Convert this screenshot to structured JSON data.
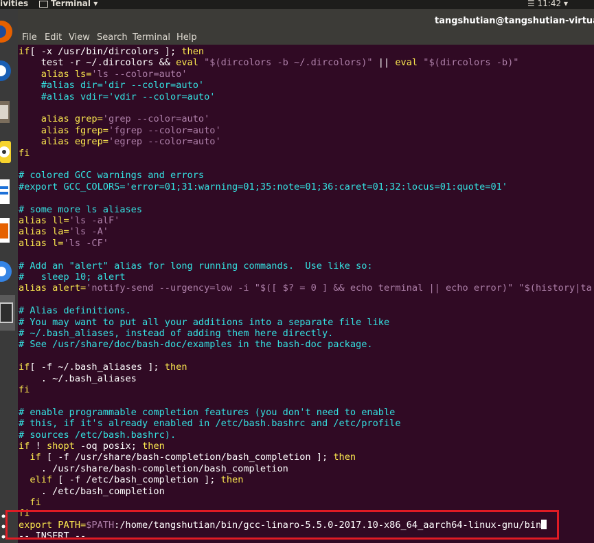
{
  "topbar": {
    "activities": "ivities",
    "app_menu": "Terminal ▾",
    "clock": "☰ 11:42 ▾"
  },
  "window": {
    "title": "tangshutian@tangshutian-virtual-m"
  },
  "menu": [
    "File",
    "Edit",
    "View",
    "Search",
    "Terminal",
    "Help"
  ],
  "terminal": {
    "lines": [
      [
        [
          "kw",
          "if"
        ],
        [
          "",
          "[ -x /usr/bin/dircolors ]; "
        ],
        [
          "kw",
          "then"
        ]
      ],
      [
        [
          "",
          "    test -r ~/.dircolors && "
        ],
        [
          "kw",
          "eval"
        ],
        [
          "st",
          " \"$(dircolors -b ~/.dircolors)\""
        ],
        [
          "",
          " || "
        ],
        [
          "kw",
          "eval"
        ],
        [
          "st",
          " \"$(dircolors -b)\""
        ]
      ],
      [
        [
          "",
          "    "
        ],
        [
          "kw",
          "alias ls="
        ],
        [
          "st",
          "'ls --color=auto'"
        ]
      ],
      [
        [
          "cm",
          "    #alias dir='dir --color=auto'"
        ]
      ],
      [
        [
          "cm",
          "    #alias vdir='vdir --color=auto'"
        ]
      ],
      [
        [
          "",
          ""
        ]
      ],
      [
        [
          "",
          "    "
        ],
        [
          "kw",
          "alias grep="
        ],
        [
          "st",
          "'grep --color=auto'"
        ]
      ],
      [
        [
          "",
          "    "
        ],
        [
          "kw",
          "alias fgrep="
        ],
        [
          "st",
          "'fgrep --color=auto'"
        ]
      ],
      [
        [
          "",
          "    "
        ],
        [
          "kw",
          "alias egrep="
        ],
        [
          "st",
          "'egrep --color=auto'"
        ]
      ],
      [
        [
          "kw",
          "fi"
        ]
      ],
      [
        [
          "",
          ""
        ]
      ],
      [
        [
          "cm",
          "# colored GCC warnings and errors"
        ]
      ],
      [
        [
          "cm",
          "#export GCC_COLORS='error=01;31:warning=01;35:note=01;36:caret=01;32:locus=01:quote=01'"
        ]
      ],
      [
        [
          "",
          ""
        ]
      ],
      [
        [
          "cm",
          "# some more ls aliases"
        ]
      ],
      [
        [
          "kw",
          "alias ll="
        ],
        [
          "st",
          "'ls -alF'"
        ]
      ],
      [
        [
          "kw",
          "alias la="
        ],
        [
          "st",
          "'ls -A'"
        ]
      ],
      [
        [
          "kw",
          "alias l="
        ],
        [
          "st",
          "'ls -CF'"
        ]
      ],
      [
        [
          "",
          ""
        ]
      ],
      [
        [
          "cm",
          "# Add an \"alert\" alias for long running commands.  Use like so:"
        ]
      ],
      [
        [
          "cm",
          "#   sleep 10; alert"
        ]
      ],
      [
        [
          "kw",
          "alias alert="
        ],
        [
          "st",
          "'notify-send --urgency=low -i \"$([ $? = 0 ] && echo terminal || echo error)\" \"$(history|ta"
        ]
      ],
      [
        [
          "",
          ""
        ]
      ],
      [
        [
          "cm",
          "# Alias definitions."
        ]
      ],
      [
        [
          "cm",
          "# You may want to put all your additions into a separate file like"
        ]
      ],
      [
        [
          "cm",
          "# ~/.bash_aliases, instead of adding them here directly."
        ]
      ],
      [
        [
          "cm",
          "# See /usr/share/doc/bash-doc/examples in the bash-doc package."
        ]
      ],
      [
        [
          "",
          ""
        ]
      ],
      [
        [
          "kw",
          "if"
        ],
        [
          "",
          "[ -f ~/.bash_aliases ]; "
        ],
        [
          "kw",
          "then"
        ]
      ],
      [
        [
          "",
          "    . ~/.bash_aliases"
        ]
      ],
      [
        [
          "kw",
          "fi"
        ]
      ],
      [
        [
          "",
          ""
        ]
      ],
      [
        [
          "cm",
          "# enable programmable completion features (you don't need to enable"
        ]
      ],
      [
        [
          "cm",
          "# this, if it's already enabled in /etc/bash.bashrc and /etc/profile"
        ]
      ],
      [
        [
          "cm",
          "# sources /etc/bash.bashrc)."
        ]
      ],
      [
        [
          "kw",
          "if"
        ],
        [
          "",
          " ! "
        ],
        [
          "kw",
          "shopt"
        ],
        [
          "",
          " -oq posix; "
        ],
        [
          "kw",
          "then"
        ]
      ],
      [
        [
          "",
          "  "
        ],
        [
          "kw",
          "if"
        ],
        [
          "",
          " [ -f /usr/share/bash-completion/bash_completion ]; "
        ],
        [
          "kw",
          "then"
        ]
      ],
      [
        [
          "",
          "    . /usr/share/bash-completion/bash_completion"
        ]
      ],
      [
        [
          "",
          "  "
        ],
        [
          "kw",
          "elif"
        ],
        [
          "",
          " [ -f /etc/bash_completion ]; "
        ],
        [
          "kw",
          "then"
        ]
      ],
      [
        [
          "",
          "    . /etc/bash_completion"
        ]
      ],
      [
        [
          "",
          "  "
        ],
        [
          "kw",
          "fi"
        ]
      ],
      [
        [
          "kw",
          "fi"
        ]
      ],
      [
        [
          "kw",
          "export"
        ],
        [
          "",
          " "
        ],
        [
          "kw",
          "PATH="
        ],
        [
          "st",
          "$PATH"
        ],
        [
          "",
          ":/home/tangshutian/bin/gcc-linaro-5.5.0-2017.10-x86_64_aarch64-linux-gnu/bin"
        ],
        [
          "cu",
          ""
        ]
      ],
      [
        [
          "",
          "-- INSERT --"
        ]
      ]
    ]
  }
}
